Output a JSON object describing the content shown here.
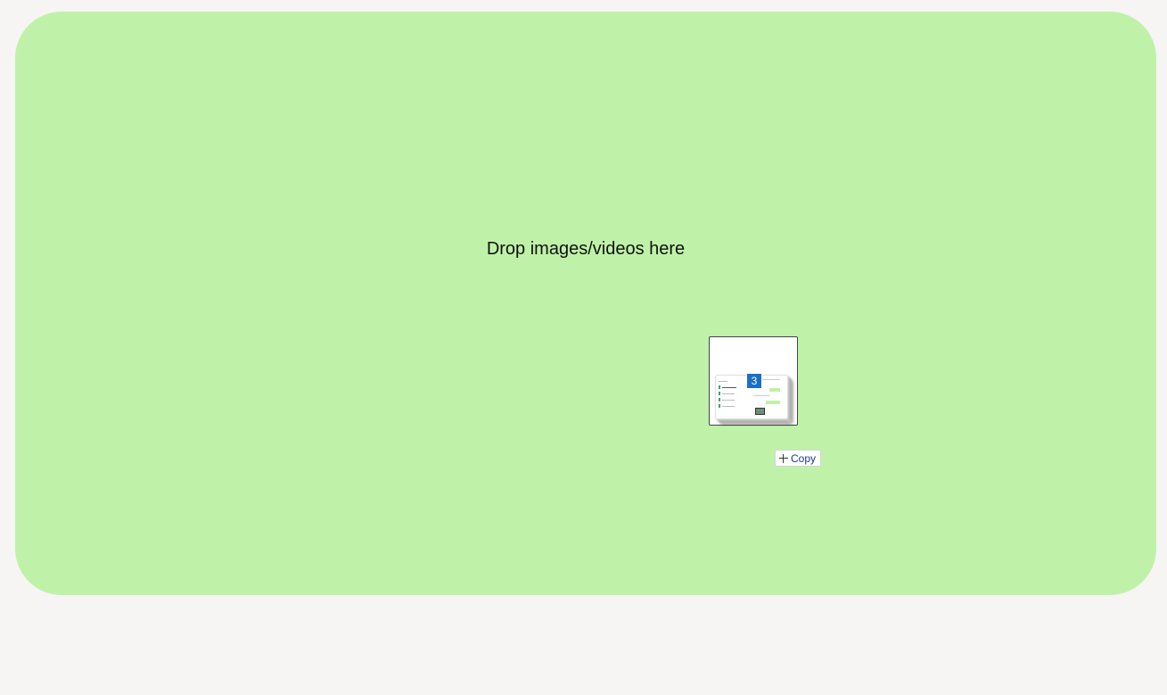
{
  "dropzone": {
    "label": "Drop images/videos here",
    "background_color": "#bff2a8"
  },
  "drag_preview": {
    "item_count": "3",
    "badge_color": "#1a6fc9"
  },
  "drag_effect": {
    "icon": "plus-icon",
    "label": "Copy"
  },
  "page": {
    "background_color": "#f6f5f4"
  }
}
